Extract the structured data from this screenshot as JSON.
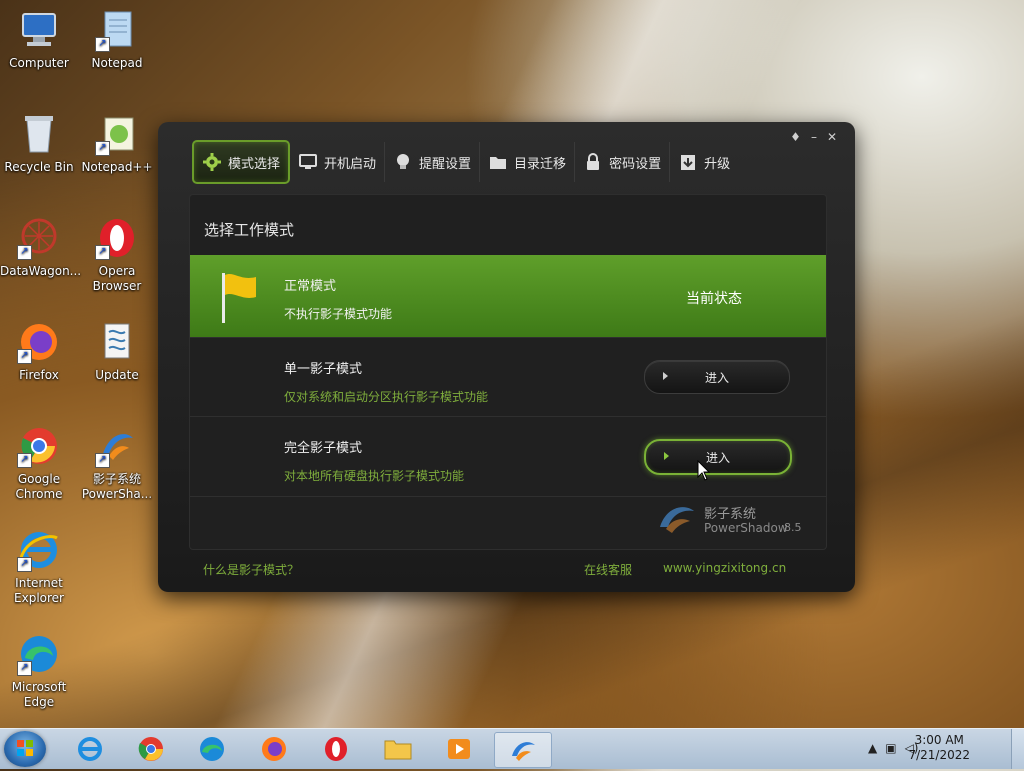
{
  "desktop": {
    "icons": [
      {
        "label": "Computer"
      },
      {
        "label": "Notepad"
      },
      {
        "label": "Recycle Bin"
      },
      {
        "label": "Notepad++"
      },
      {
        "label": "DataWagon..."
      },
      {
        "label": "Opera Browser"
      },
      {
        "label": "Firefox"
      },
      {
        "label": "Update"
      },
      {
        "label": "Google Chrome"
      },
      {
        "label": "影子系统 PowerSha..."
      },
      {
        "label": "Internet Explorer"
      },
      {
        "label": "Microsoft Edge"
      }
    ]
  },
  "app": {
    "controls": {
      "skin": "♦",
      "minimize": "–",
      "close": "✕"
    },
    "tabs": [
      {
        "label": "模式选择",
        "icon": "gear-icon"
      },
      {
        "label": "开机启动",
        "icon": "monitor-icon"
      },
      {
        "label": "提醒设置",
        "icon": "bulb-icon"
      },
      {
        "label": "目录迁移",
        "icon": "folder-icon"
      },
      {
        "label": "密码设置",
        "icon": "lock-icon"
      },
      {
        "label": "升级",
        "icon": "upgrade-icon"
      }
    ],
    "panel_title": "选择工作模式",
    "modes": [
      {
        "name": "正常模式",
        "desc": "不执行影子模式功能",
        "status": "当前状态"
      },
      {
        "name": "单一影子模式",
        "desc": "仅对系统和启动分区执行影子模式功能",
        "button": "进入"
      },
      {
        "name": "完全影子模式",
        "desc": "对本地所有硬盘执行影子模式功能",
        "button": "进入"
      }
    ],
    "brand": {
      "cn": "影子系统",
      "en": "PowerShadow",
      "version": "8.5"
    },
    "footer": {
      "help_link": "什么是影子模式？",
      "support_link": "在线客服",
      "site_link": "www.yingzixitong.cn"
    },
    "accent": "#5f9f2a"
  },
  "taskbar": {
    "time": "3:00 AM",
    "date": "7/21/2022"
  }
}
